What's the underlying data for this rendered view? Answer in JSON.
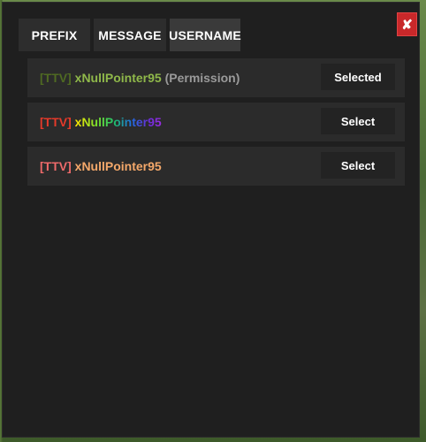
{
  "tabs": [
    {
      "label": "PREFIX"
    },
    {
      "label": "MESSAGE"
    },
    {
      "label": "USERNAME"
    }
  ],
  "close_icon": "close-icon",
  "colors": {
    "panel_bg": "#1f1f1f",
    "row_bg": "#2b2b2b",
    "close_bg": "#c8282a",
    "tab_active_bg": "#3a3a3a"
  },
  "rows": [
    {
      "prefix": "[TTV]",
      "name": "xNullPointer95",
      "suffix": "(Permission)",
      "button_label": "Selected",
      "style": "green-gradient"
    },
    {
      "prefix": "[TTV]",
      "name": "xNullPointer95",
      "button_label": "Select",
      "style": "rainbow"
    },
    {
      "prefix": "[TTV]",
      "name": "xNullPointer95",
      "button_label": "Select",
      "style": "salmon-gradient"
    }
  ]
}
